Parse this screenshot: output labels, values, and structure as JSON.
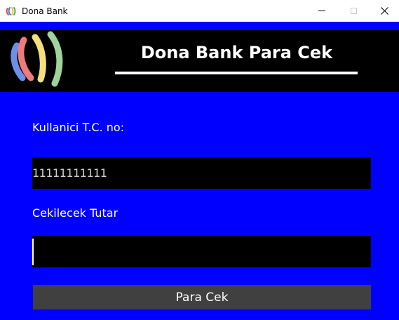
{
  "window": {
    "title": "Dona Bank",
    "app_icon": "dona-bank-logo-icon",
    "controls": {
      "minimize": "minimize-icon",
      "maximize": "maximize-icon",
      "close": "close-icon"
    }
  },
  "header": {
    "title": "Dona Bank Para Cek",
    "logo": "dona-bank-logo-icon"
  },
  "form": {
    "tc_label": "Kullanici T.C. no:",
    "tc_value": "11111111111",
    "amount_label": "Cekilecek Tutar",
    "amount_value": "",
    "submit_label": "Para Cek"
  },
  "colors": {
    "background": "#0000ff",
    "header": "#000000",
    "input": "#000000",
    "button": "#404040",
    "text": "#ffffff"
  }
}
